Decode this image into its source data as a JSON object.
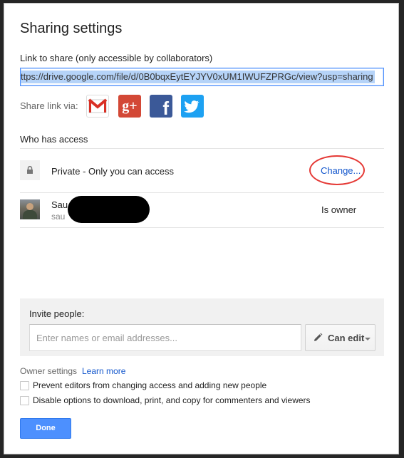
{
  "dialog": {
    "title": "Sharing settings"
  },
  "link_share": {
    "label": "Link to share (only accessible by collaborators)",
    "url": "ttps://drive.google.com/file/d/0B0bqxEytEYJYV0xUM1IWUFZPRGc/view?usp=sharing"
  },
  "share_via": {
    "label": "Share link via:",
    "services": [
      "gmail-icon",
      "google-plus-icon",
      "facebook-icon",
      "twitter-icon"
    ]
  },
  "access": {
    "heading": "Who has access",
    "visibility_text": "Private - Only you can access",
    "change_label": "Change...",
    "owner": {
      "name": "Sau",
      "email": "sau",
      "role": "Is owner"
    }
  },
  "invite": {
    "label": "Invite people:",
    "placeholder": "Enter names or email addresses...",
    "permission": "Can edit"
  },
  "owner_settings": {
    "label": "Owner settings",
    "learn_more": "Learn more",
    "options": [
      {
        "label": "Prevent editors from changing access and adding new people",
        "checked": false
      },
      {
        "label": "Disable options to download, print, and copy for commenters and viewers",
        "checked": false
      }
    ]
  },
  "done_label": "Done",
  "colors": {
    "accent": "#4d90fe",
    "link": "#1155cc",
    "annotation": "#e53935"
  }
}
